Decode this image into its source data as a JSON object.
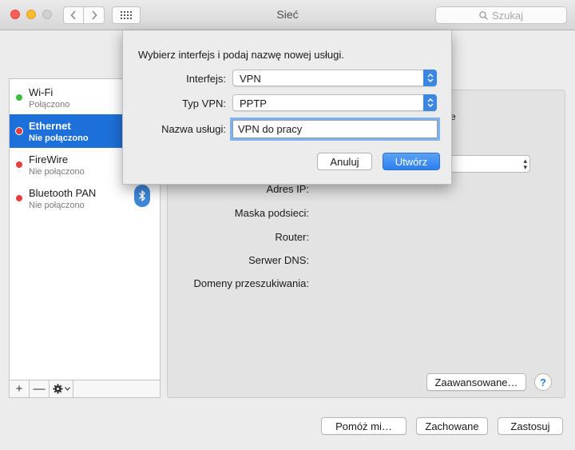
{
  "window": {
    "title": "Sieć"
  },
  "toolbar": {
    "search_placeholder": "Szukaj"
  },
  "sidebar": {
    "services": [
      {
        "name": "Wi-Fi",
        "status": "Połączono",
        "status_color": "#3fbb41"
      },
      {
        "name": "Ethernet",
        "status": "Nie połączono",
        "status_color": "#e33f3f"
      },
      {
        "name": "FireWire",
        "status": "Nie połączono",
        "status_color": "#e33f3f"
      },
      {
        "name": "Bluetooth PAN",
        "status": "Nie połączono",
        "status_color": "#e33f3f"
      }
    ],
    "selected": "Ethernet",
    "add_label": "+",
    "remove_label": "—"
  },
  "panel": {
    "labels": {
      "ip_address": "Adres IP:",
      "subnet_mask": "Maska podsieci:",
      "router": "Router:",
      "dns": "Serwer DNS:",
      "search_domains": "Domeny przeszukiwania:"
    },
    "truncated_text": "e",
    "advanced_button": "Zaawansowane…",
    "help_label": "?"
  },
  "footer": {
    "assist_button": "Pomóż mi…",
    "revert_button": "Zachowane",
    "apply_button": "Zastosuj"
  },
  "dialog": {
    "prompt": "Wybierz interfejs i podaj nazwę nowej usługi.",
    "interface_label": "Interfejs:",
    "interface_value": "VPN",
    "vpn_type_label": "Typ VPN:",
    "vpn_type_value": "PPTP",
    "service_name_label": "Nazwa usługi:",
    "service_name_value": "VPN do pracy",
    "cancel_button": "Anuluj",
    "create_button": "Utwórz"
  },
  "colors": {
    "accent": "#2d7ff0",
    "selection": "#1d70d9"
  }
}
